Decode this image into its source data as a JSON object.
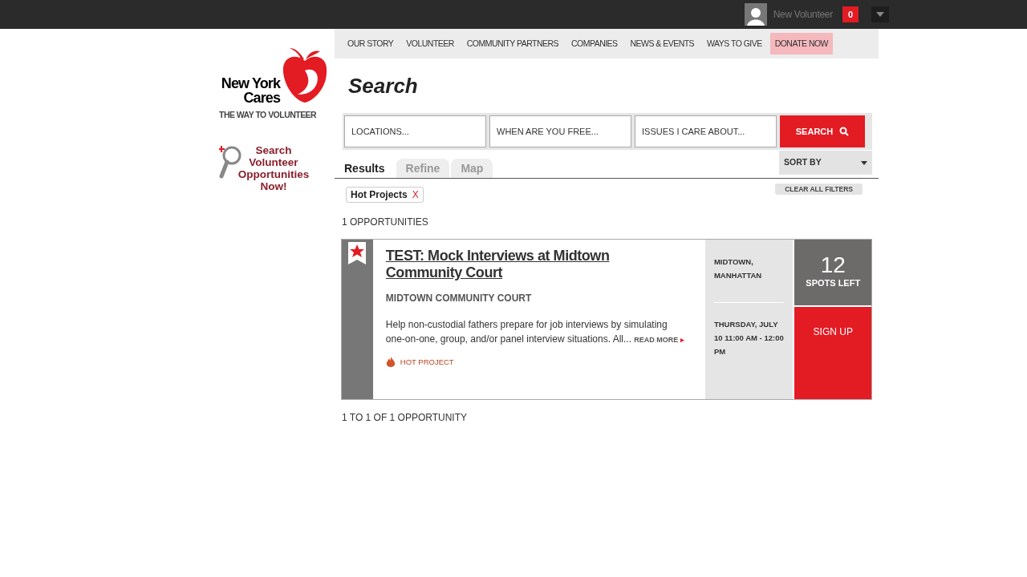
{
  "top_bar": {
    "user_name": "New Volunteer",
    "notification_count": "0"
  },
  "logo": {
    "line1": "New York",
    "line2": "Cares",
    "tagline": "THE WAY TO VOLUNTEER"
  },
  "side_link": "Search Volunteer Opportunities Now!",
  "nav": [
    {
      "label": "OUR STORY",
      "kind": "link"
    },
    {
      "label": "VOLUNTEER",
      "kind": "link"
    },
    {
      "label": "COMMUNITY PARTNERS",
      "kind": "link"
    },
    {
      "label": "COMPANIES",
      "kind": "link"
    },
    {
      "label": "NEWS & EVENTS",
      "kind": "link"
    },
    {
      "label": "WAYS TO GIVE",
      "kind": "link"
    },
    {
      "label": "DONATE NOW",
      "kind": "donate"
    }
  ],
  "page_title": "Search",
  "search": {
    "fields": [
      {
        "placeholder": "LOCATIONS..."
      },
      {
        "placeholder": "WHEN ARE YOU FREE..."
      },
      {
        "placeholder": "ISSUES I CARE ABOUT..."
      }
    ],
    "button": "SEARCH"
  },
  "tabs": [
    {
      "label": "Results",
      "selected": true
    },
    {
      "label": "Refine",
      "selected": false
    },
    {
      "label": "Map",
      "selected": false
    }
  ],
  "sort": "SORT BY",
  "filters": [
    {
      "label": "Hot Projects",
      "remove": "X"
    }
  ],
  "clear_filters": "CLEAR ALL FILTERS",
  "count": "1 OPPORTUNITIES",
  "results": [
    {
      "title": "TEST: Mock Interviews at Midtown Community Court",
      "featured": true,
      "organization": "MIDTOWN COMMUNITY COURT",
      "description": "Help non-custodial fathers prepare for job interviews by simulating one-on-one, group, and/or panel interview situations. All...",
      "read_more": "READ MORE",
      "read_more_arrow": "▸",
      "tag": "HOT PROJECT",
      "location": "MIDTOWN, MANHATTAN",
      "date": "THURSDAY, JULY 10 11:00 AM - 12:00 PM",
      "spots": "12",
      "spots_label": "SPOTS LEFT",
      "signup": "SIGN UP"
    }
  ],
  "footer_count": "1 TO 1 OF 1 OPPORTUNITY"
}
